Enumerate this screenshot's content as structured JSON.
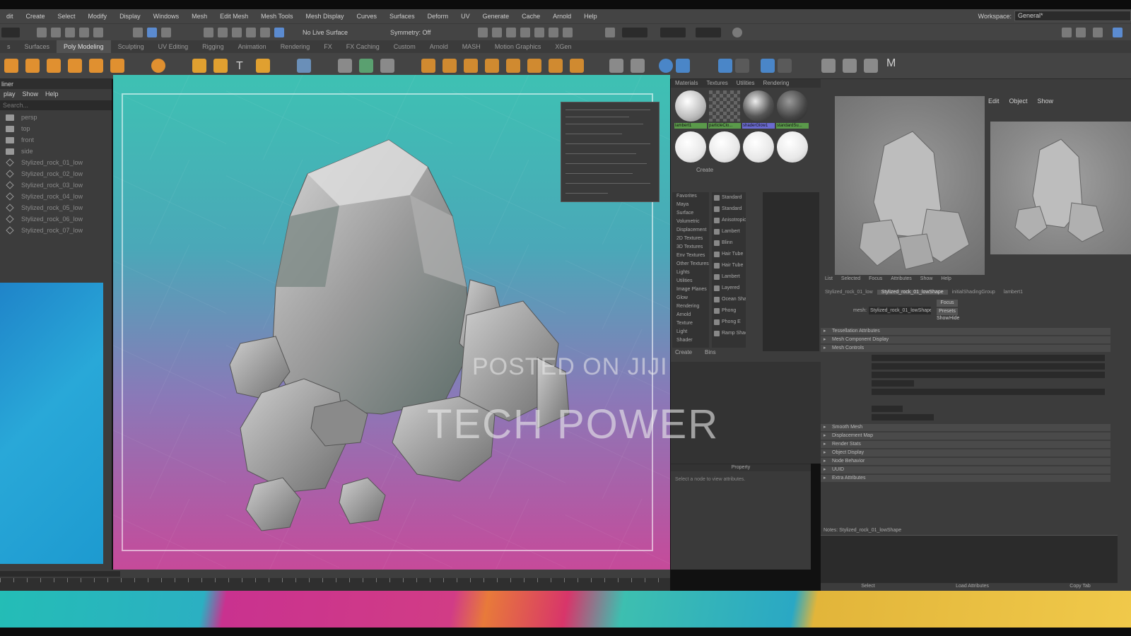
{
  "menubar": {
    "items": [
      "dit",
      "Create",
      "Select",
      "Modify",
      "Display",
      "Windows",
      "Mesh",
      "Edit Mesh",
      "Mesh Tools",
      "Mesh Display",
      "Curves",
      "Surfaces",
      "Deform",
      "UV",
      "Generate",
      "Cache",
      "Arnold",
      "Help"
    ],
    "workspace_label": "Workspace:",
    "workspace_value": "General*"
  },
  "statusline": {
    "live_surface": "No Live Surface",
    "symmetry": "Symmetry: Off"
  },
  "shelf_tabs": {
    "items": [
      "s",
      "Surfaces",
      "Poly Modeling",
      "Sculpting",
      "UV Editing",
      "Rigging",
      "Animation",
      "Rendering",
      "FX",
      "FX Caching",
      "Custom",
      "Arnold",
      "MASH",
      "Motion Graphics",
      "XGen"
    ],
    "active_index": 2
  },
  "outliner": {
    "title": "liner",
    "menu": [
      "play",
      "Show",
      "Help"
    ],
    "search_placeholder": "Search...",
    "items": [
      {
        "label": "persp",
        "type": "camera"
      },
      {
        "label": "top",
        "type": "camera"
      },
      {
        "label": "front",
        "type": "camera"
      },
      {
        "label": "side",
        "type": "camera"
      },
      {
        "label": "Stylized_rock_01_low",
        "type": "mesh"
      },
      {
        "label": "Stylized_rock_02_low",
        "type": "mesh"
      },
      {
        "label": "Stylized_rock_03_low",
        "type": "mesh"
      },
      {
        "label": "Stylized_rock_04_low",
        "type": "mesh"
      },
      {
        "label": "Stylized_rock_05_low",
        "type": "mesh"
      },
      {
        "label": "Stylized_rock_06_low",
        "type": "mesh"
      },
      {
        "label": "Stylized_rock_07_low",
        "type": "mesh"
      }
    ]
  },
  "hypershade": {
    "tabs": [
      "Materials",
      "Textures",
      "Utilities",
      "Rendering"
    ],
    "swatch_labels": [
      "lambert1",
      "particleClo...",
      "shaderGlow1",
      "standardSu..."
    ],
    "create_label": "Create",
    "node_categories": [
      "Favorites",
      "Maya",
      "Surface",
      "Volumetric",
      "Displacement",
      "2D Textures",
      "3D Textures",
      "Env Textures",
      "Other Textures",
      "Lights",
      "Utilities",
      "Image Planes",
      "Glow",
      "Rendering",
      "Arnold",
      "Texture",
      "Light",
      "Shader",
      "Utility"
    ],
    "node_types": [
      "Standard",
      "Standard",
      "Anisotropic",
      "Lambert",
      "Blinn",
      "Hair Tube",
      "Hair Tube",
      "Lambert",
      "Layered",
      "Ocean Shader",
      "Phong",
      "Phong E",
      "Ramp Shader"
    ],
    "bottom_tabs": [
      "Create",
      "Bins"
    ],
    "property_title": "Property",
    "property_hint": "Select a node to view attributes."
  },
  "attribute_editor": {
    "tabs": [
      "Edit",
      "Object",
      "Show"
    ],
    "render_caption": [
      "List",
      "Selected",
      "Focus",
      "Attributes",
      "Show",
      "Help"
    ],
    "node_tabs": [
      "Stylized_rock_01_low",
      "Stylized_rock_01_lowShape",
      "initialShadingGroup",
      "lambert1"
    ],
    "mesh_label": "mesh:",
    "mesh_value": "Stylized_rock_01_lowShape",
    "focus_btn": "Focus",
    "presets_btn": "Presets",
    "show_btn": "Show",
    "hide_btn": "Hide",
    "sections": [
      "Tessellation Attributes",
      "Mesh Component Display",
      "Mesh Controls",
      "Smooth Mesh",
      "Displacement Map",
      "Render Stats",
      "Object Display",
      "Node Behavior",
      "UUID",
      "Extra Attributes"
    ],
    "notes_label": "Notes: Stylized_rock_01_lowShape",
    "buttons": [
      "Select",
      "Load Attributes",
      "Copy Tab"
    ]
  },
  "watermark": {
    "line1": "POSTED ON JIJI",
    "line2": "TECH POWER"
  }
}
